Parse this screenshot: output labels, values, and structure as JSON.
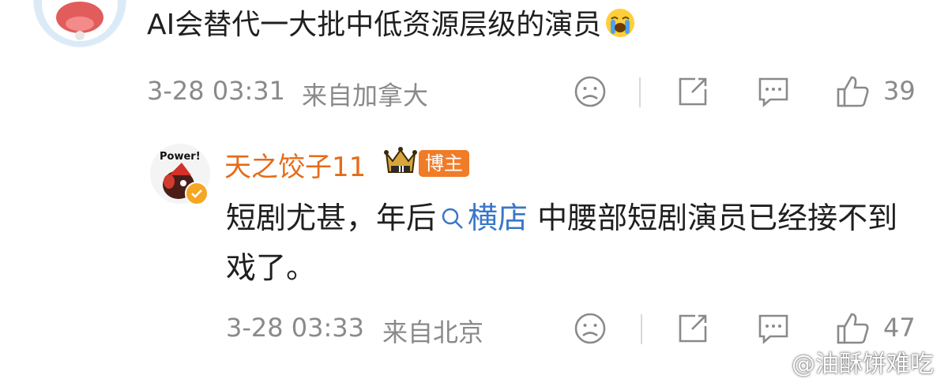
{
  "top_comment": {
    "text": "AI会替代一大批中低资源层级的演员",
    "time": "3-28 03:31",
    "location": "来自加拿大",
    "like_count": "39",
    "emoji_icon": "crying-face-icon"
  },
  "reply": {
    "username": "天之饺子11",
    "badge": "博主",
    "avatar_text": "Power!",
    "text_before_link": "短剧尤甚，年后",
    "link_text": "横店",
    "text_after_link": " 中腰部短剧演员已经接不到戏了。",
    "time": "3-28 03:33",
    "location": "来自北京",
    "like_count": "47"
  },
  "watermark": "@油酥饼难吃",
  "colors": {
    "username": "#e66b17",
    "badge": "#f07c28",
    "link": "#3a76c8",
    "meta": "#8a8a8a"
  }
}
